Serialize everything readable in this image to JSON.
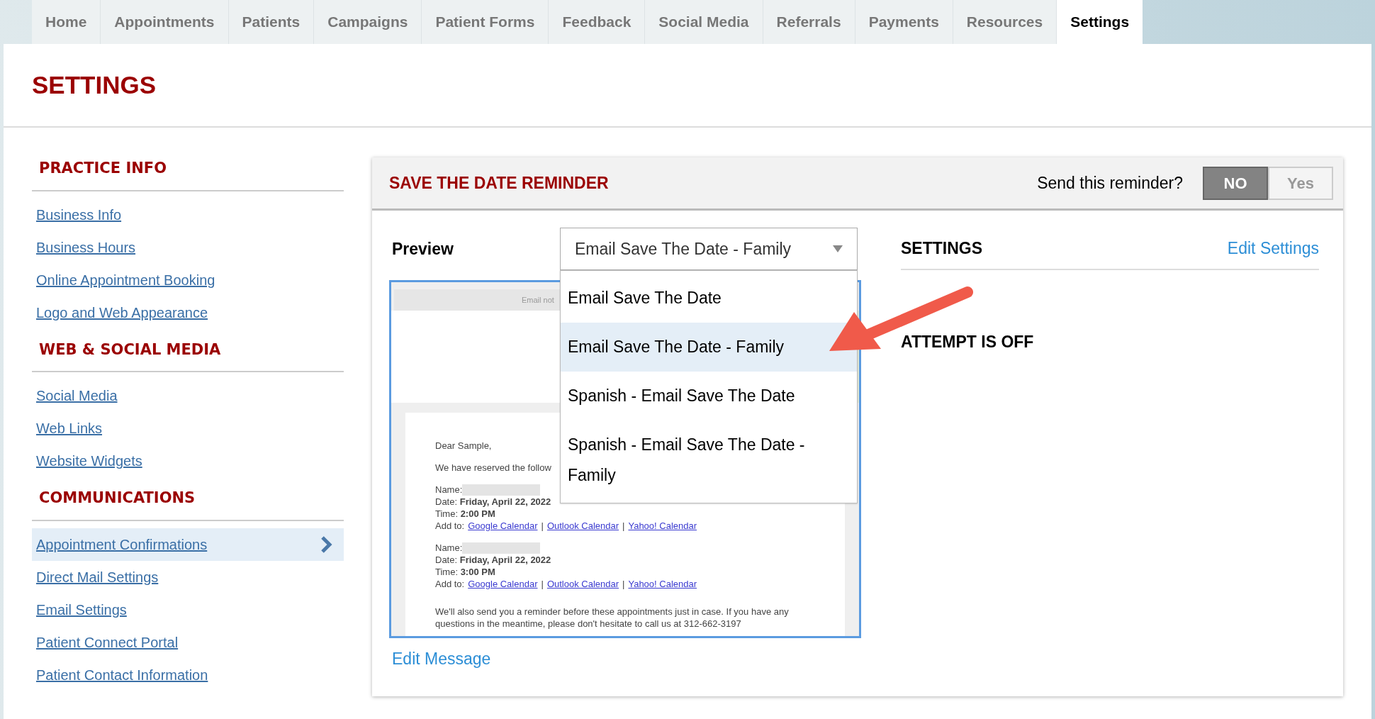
{
  "nav": {
    "tabs": [
      {
        "label": "Home",
        "selected": false
      },
      {
        "label": "Appointments",
        "selected": false
      },
      {
        "label": "Patients",
        "selected": false
      },
      {
        "label": "Campaigns",
        "selected": false
      },
      {
        "label": "Patient Forms",
        "selected": false
      },
      {
        "label": "Feedback",
        "selected": false
      },
      {
        "label": "Social Media",
        "selected": false
      },
      {
        "label": "Referrals",
        "selected": false
      },
      {
        "label": "Payments",
        "selected": false
      },
      {
        "label": "Resources",
        "selected": false
      },
      {
        "label": "Settings",
        "selected": true
      }
    ]
  },
  "page_title": "SETTINGS",
  "sidebar": {
    "sections": [
      {
        "title": "PRACTICE INFO",
        "items": [
          {
            "label": "Business Info",
            "selected": false
          },
          {
            "label": "Business Hours",
            "selected": false
          },
          {
            "label": "Online Appointment Booking",
            "selected": false
          },
          {
            "label": "Logo and Web Appearance",
            "selected": false
          }
        ]
      },
      {
        "title": "WEB & SOCIAL MEDIA",
        "items": [
          {
            "label": "Social Media",
            "selected": false
          },
          {
            "label": "Web Links",
            "selected": false
          },
          {
            "label": "Website Widgets",
            "selected": false
          }
        ]
      },
      {
        "title": "COMMUNICATIONS",
        "items": [
          {
            "label": "Appointment Confirmations",
            "selected": true
          },
          {
            "label": "Direct Mail Settings",
            "selected": false
          },
          {
            "label": "Email Settings",
            "selected": false
          },
          {
            "label": "Patient Connect Portal",
            "selected": false
          },
          {
            "label": "Patient Contact Information",
            "selected": false
          }
        ]
      }
    ]
  },
  "reminder": {
    "title": "SAVE THE DATE REMINDER",
    "send_prompt": "Send this reminder?",
    "toggle": [
      {
        "label": "NO",
        "selected": true
      },
      {
        "label": "Yes",
        "selected": false
      }
    ],
    "preview": {
      "label": "Preview",
      "dropdown": {
        "value": "Email Save The Date - Family",
        "options": [
          {
            "label": "Email Save The Date",
            "selected": false
          },
          {
            "label": "Email Save The Date - Family",
            "selected": true
          },
          {
            "label": "Spanish - Email Save The Date",
            "selected": false
          },
          {
            "label": "Spanish - Email Save The Date - Family",
            "selected": false
          }
        ]
      },
      "email": {
        "header_text": "Email not",
        "greeting": "Dear Sample,",
        "intro": "We have reserved the follow",
        "appointments": [
          {
            "name_label": "Name:",
            "date": "Date: **Friday, April 22, 2022**",
            "time": "Time: **2:00 PM**",
            "add_to": "Add to:",
            "separator": "|",
            "links": [
              "Google Calendar",
              "Outlook Calendar",
              "Yahoo! Calendar"
            ]
          },
          {
            "name_label": "Name:",
            "date": "Date: **Friday, April 22, 2022**",
            "time": "Time: **3:00 PM**",
            "add_to": "Add to:",
            "separator": "|",
            "links": [
              "Google Calendar",
              "Outlook Calendar",
              "Yahoo! Calendar"
            ]
          }
        ],
        "closing": "We'll also send you a reminder before these appointments just in case. If you have any questions in the meantime, please don't hesitate to call us at 312-662-3197"
      },
      "edit_link": "Edit Message"
    },
    "settings_panel": {
      "title": "SETTINGS",
      "edit_link": "Edit Settings",
      "status": "ATTEMPT IS OFF"
    }
  }
}
